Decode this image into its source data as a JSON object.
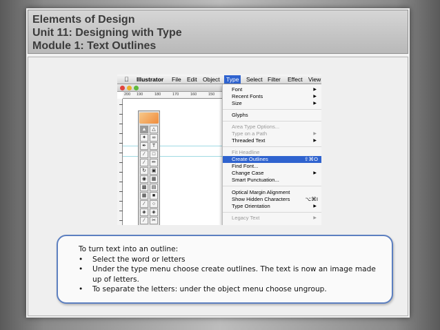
{
  "slide": {
    "title_lines": [
      "Elements of Design",
      "Unit 11: Designing with Type",
      "Module 1: Text Outlines"
    ]
  },
  "app_menubar": {
    "apple_icon": "apple-logo-icon",
    "items": [
      "Illustrator",
      "File",
      "Edit",
      "Object",
      "Type",
      "Select",
      "Filter",
      "Effect",
      "View"
    ],
    "active": "Type"
  },
  "ruler": {
    "top_labels": [
      "200",
      "190",
      "180",
      "170",
      "160",
      "150"
    ]
  },
  "type_menu": {
    "items": [
      {
        "label": "Font",
        "submenu": true,
        "disabled": false
      },
      {
        "label": "Recent Fonts",
        "submenu": true,
        "disabled": false
      },
      {
        "label": "Size",
        "submenu": true,
        "disabled": false
      },
      {
        "label": "Glyphs",
        "submenu": false,
        "disabled": false
      },
      {
        "label": "Area Type Options...",
        "submenu": false,
        "disabled": true
      },
      {
        "label": "Type on a Path",
        "submenu": true,
        "disabled": true
      },
      {
        "label": "Threaded Text",
        "submenu": true,
        "disabled": false
      },
      {
        "label": "Fit Headline",
        "submenu": false,
        "disabled": true
      },
      {
        "label": "Create Outlines",
        "shortcut": "⇧⌘O",
        "highlighted": true
      },
      {
        "label": "Find Font...",
        "submenu": false,
        "disabled": false
      },
      {
        "label": "Change Case",
        "submenu": true,
        "disabled": false
      },
      {
        "label": "Smart Punctuation...",
        "submenu": false,
        "disabled": false
      },
      {
        "label": "Optical Margin Alignment",
        "submenu": false,
        "disabled": false
      },
      {
        "label": "Show Hidden Characters",
        "shortcut": "⌥⌘I",
        "disabled": false
      },
      {
        "label": "Type Orientation",
        "submenu": true,
        "disabled": false
      },
      {
        "label": "Legacy Text",
        "submenu": true,
        "disabled": true
      }
    ]
  },
  "tools_panel": {
    "icons": [
      "selection-tool-icon",
      "direct-selection-tool-icon",
      "magic-wand-icon",
      "lasso-icon",
      "pen-tool-icon",
      "type-tool-icon",
      "line-tool-icon",
      "rectangle-tool-icon",
      "paintbrush-icon",
      "pencil-icon",
      "rotate-tool-icon",
      "scale-tool-icon",
      "warp-tool-icon",
      "free-transform-icon",
      "symbol-sprayer-icon",
      "graph-tool-icon",
      "mesh-tool-icon",
      "gradient-tool-icon",
      "eyedropper-icon",
      "blend-tool-icon",
      "live-paint-icon",
      "live-paint-selection-icon",
      "slice-tool-icon",
      "scissors-icon"
    ]
  },
  "instructions": {
    "intro": "To turn text into an outline:",
    "bullets": [
      "Select the word or letters",
      "Under the type menu choose create outlines. The text is now an image made up of letters.",
      "To separate the letters: under the object menu choose ungroup."
    ]
  }
}
